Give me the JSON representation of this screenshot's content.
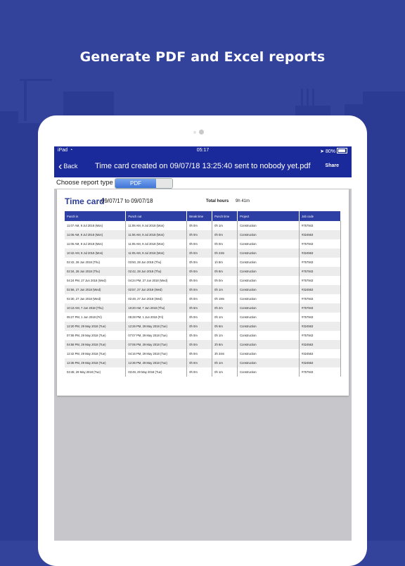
{
  "promo": {
    "headline": "Generate PDF and Excel reports"
  },
  "status_bar": {
    "carrier": "iPad",
    "time": "05:17",
    "battery": "80%"
  },
  "nav": {
    "back_label": "Back",
    "title": "Time card created on 09/07/18 13:25:40 sent to nobody yet.pdf",
    "share_label": "Share"
  },
  "report_type": {
    "label": "Choose report type",
    "selected": "PDF"
  },
  "timecard": {
    "title": "Time card",
    "date_range": "09/07/17 to  09/07/18",
    "total_hours_label": "Total hours",
    "total_hours_value": "9h 41m",
    "columns": [
      "Punch in",
      "Punch out",
      "Break time",
      "Punch time",
      "Project",
      "Job code"
    ],
    "rows": [
      [
        "11:07 AM, 9 Jul 2018 (Mon)",
        "11:08 AM, 9 Jul 2018 (Mon)",
        "0h 0m",
        "0h 1m",
        "Construction",
        "#757943"
      ],
      [
        "11:06 AM, 9 Jul 2018 (Mon)",
        "11:06 AM, 9 Jul 2018 (Mon)",
        "0h 0m",
        "0h 0m",
        "Construction",
        "#324563"
      ],
      [
        "11:05 AM, 9 Jul 2018 (Mon)",
        "11:05 AM, 9 Jul 2018 (Mon)",
        "0h 0m",
        "0h 0m",
        "Construction",
        "#757943"
      ],
      [
        "10:42 AM, 9 Jul 2018 (Mon)",
        "11:05 AM, 9 Jul 2018 (Mon)",
        "0h 0m",
        "0h 23m",
        "Construction",
        "#324563"
      ],
      [
        "02:42, 28 Jun 2018 (Thu)",
        "03:50, 28 Jun 2018 (Thu)",
        "0h 0m",
        "1h 8m",
        "Construction",
        "#757943"
      ],
      [
        "02:34, 28 Jun 2018 (Thu)",
        "02:42, 28 Jun 2018 (Thu)",
        "0h 0m",
        "0h 8m",
        "Construction",
        "#757943"
      ],
      [
        "04:24 PM, 27 Jun 2018 (Wed)",
        "04:24 PM, 27 Jun 2018 (Wed)",
        "0h 0m",
        "0h 0m",
        "Construction",
        "#757943"
      ],
      [
        "02:56, 27 Jun 2018 (Wed)",
        "02:57, 27 Jun 2018 (Wed)",
        "0h 0m",
        "0h 1m",
        "Construction",
        "#324563"
      ],
      [
        "02:30, 27 Jun 2018 (Wed)",
        "02:49, 27 Jun 2018 (Wed)",
        "0h 0m",
        "0h 19m",
        "Construction",
        "#757943"
      ],
      [
        "10:13 AM, 7 Jun 2018 (Thu)",
        "10:20 AM, 7 Jun 2018 (Thu)",
        "0h 5m",
        "0h 2m",
        "Construction",
        "#757943"
      ],
      [
        "05:27 PM, 1 Jun 2018 (Fri)",
        "05:28 PM, 1 Jun 2018 (Fri)",
        "0h 0m",
        "0h 1m",
        "Construction",
        "#757943"
      ],
      [
        "12:20 PM, 29 May 2018 (Tue)",
        "12:26 PM, 29 May 2018 (Tue)",
        "0h 0m",
        "0h 6m",
        "Construction",
        "#324563"
      ],
      [
        "07:06 PM, 29 May 2018 (Tue)",
        "07:07 PM, 29 May 2018 (Tue)",
        "0h 0m",
        "0h 1m",
        "Construction",
        "#757943"
      ],
      [
        "04:58 PM, 29 May 2018 (Tue)",
        "07:06 PM, 29 May 2018 (Tue)",
        "0h 0m",
        "2h 8m",
        "Construction",
        "#324563"
      ],
      [
        "12:42 PM, 29 May 2018 (Tue)",
        "04:16 PM, 29 May 2018 (Tue)",
        "0h 0m",
        "3h 34m",
        "Construction",
        "#324563"
      ],
      [
        "12:35 PM, 29 May 2018 (Tue)",
        "12:36 PM, 29 May 2018 (Tue)",
        "0h 0m",
        "0h 1m",
        "Construction",
        "#324563"
      ],
      [
        "03:48, 29 May 2018 (Tue)",
        "03:49, 29 May 2018 (Tue)",
        "0h 0m",
        "0h 1m",
        "Construction",
        "#757943"
      ]
    ]
  },
  "colors": {
    "background": "#33439c",
    "navbar": "#1b2a9a",
    "table_header": "#2d3fa5",
    "title": "#2d3d99"
  }
}
